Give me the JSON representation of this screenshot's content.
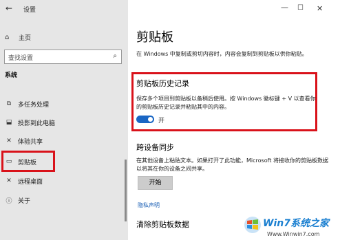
{
  "app": {
    "title": "设置",
    "back_glyph": "←"
  },
  "window_controls": {
    "minimize": "—",
    "maximize": "☐",
    "close": "✕"
  },
  "sidebar": {
    "home_label": "主页",
    "search_placeholder": "查找设置",
    "section_label": "系统",
    "items": [
      {
        "label": "多任务处理",
        "icon": "multitask-icon",
        "glyph": "⧉"
      },
      {
        "label": "投影到此电脑",
        "icon": "project-icon",
        "glyph": "⬓"
      },
      {
        "label": "体验共享",
        "icon": "share-icon",
        "glyph": "✕"
      },
      {
        "label": "剪贴板",
        "icon": "clipboard-icon",
        "glyph": "▭",
        "selected": true
      },
      {
        "label": "远程桌面",
        "icon": "remote-desktop-icon",
        "glyph": "✕"
      },
      {
        "label": "关于",
        "icon": "info-icon",
        "glyph": "ⓘ"
      }
    ]
  },
  "main": {
    "title": "剪贴板",
    "description": "在 Windows 中复制或剪切内容时，内容会复制到剪贴板以供你粘贴。",
    "history": {
      "title": "剪贴板历史记录",
      "description": "保存多个项目到剪贴板以备稍后使用。按 Windows 徽标键 + V 以查看你的剪贴板历史记录并粘贴其中的内容。",
      "toggle_state": "开",
      "toggle_on": true
    },
    "sync": {
      "title": "跨设备同步",
      "description": "在其他设备上粘贴文本。如果打开了此功能，Microsoft 将接收你的剪贴板数据以将其在你的设备之间共享。",
      "button_label": "开始"
    },
    "privacy_link": "隐私声明",
    "clear_title": "清除剪贴板数据"
  },
  "watermark": {
    "text": "Win7系统之家",
    "url": "Www.Winwin7.com"
  },
  "colors": {
    "accent": "#1a66c4",
    "highlight_border": "#d9121a",
    "sidebar_bg": "#e6e6e6"
  }
}
